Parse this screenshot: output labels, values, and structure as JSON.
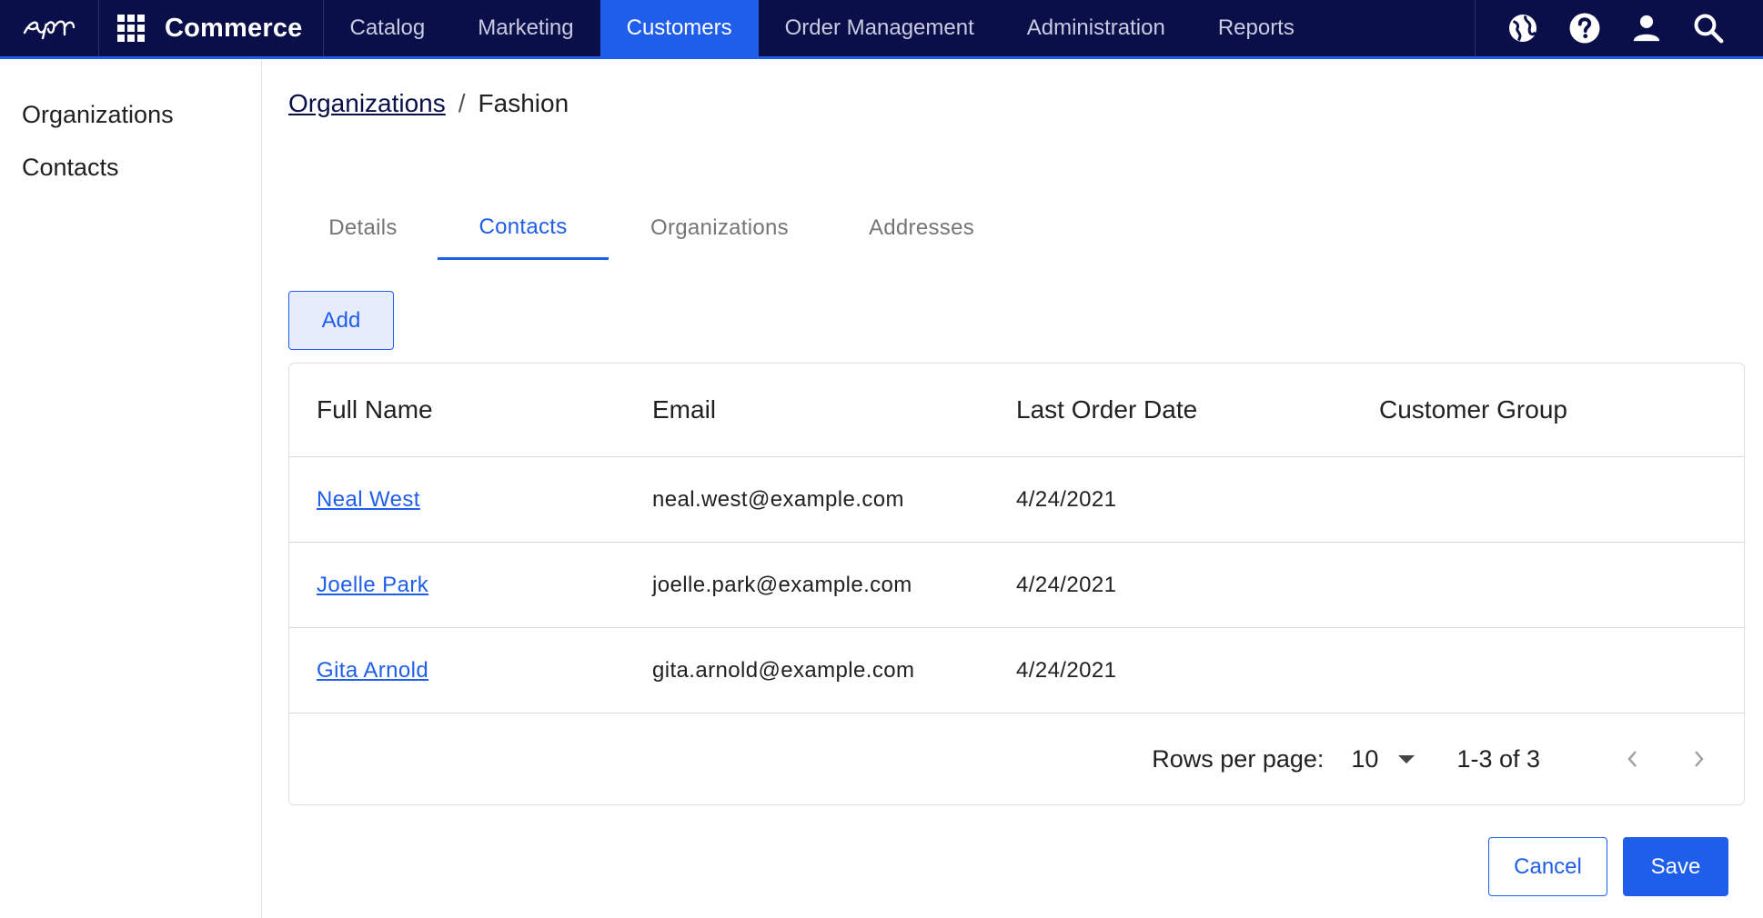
{
  "header": {
    "logo_icon": "epi-logo-icon",
    "app_menu_icon": "apps-grid-icon",
    "app_title": "Commerce",
    "nav": [
      {
        "label": "Catalog",
        "active": false
      },
      {
        "label": "Marketing",
        "active": false
      },
      {
        "label": "Customers",
        "active": true
      },
      {
        "label": "Order Management",
        "active": false
      },
      {
        "label": "Administration",
        "active": false
      },
      {
        "label": "Reports",
        "active": false
      }
    ],
    "icons": [
      "globe-icon",
      "help-icon",
      "user-icon",
      "search-icon"
    ]
  },
  "sidebar": {
    "items": [
      {
        "label": "Organizations"
      },
      {
        "label": "Contacts"
      }
    ]
  },
  "breadcrumb": {
    "parent": "Organizations",
    "separator": "/",
    "current": "Fashion"
  },
  "tabs": [
    {
      "label": "Details",
      "active": false
    },
    {
      "label": "Contacts",
      "active": true
    },
    {
      "label": "Organizations",
      "active": false
    },
    {
      "label": "Addresses",
      "active": false
    }
  ],
  "toolbar": {
    "add_label": "Add"
  },
  "table": {
    "columns": [
      "Full Name",
      "Email",
      "Last Order Date",
      "Customer Group"
    ],
    "rows": [
      {
        "full_name": "Neal West",
        "email": "neal.west@example.com",
        "last_order_date": "4/24/2021",
        "customer_group": ""
      },
      {
        "full_name": "Joelle Park",
        "email": "joelle.park@example.com",
        "last_order_date": "4/24/2021",
        "customer_group": ""
      },
      {
        "full_name": "Gita Arnold",
        "email": "gita.arnold@example.com",
        "last_order_date": "4/24/2021",
        "customer_group": ""
      }
    ]
  },
  "pagination": {
    "rows_per_page_label": "Rows per page:",
    "rows_per_page_value": "10",
    "range": "1-3 of 3"
  },
  "actions": {
    "cancel_label": "Cancel",
    "save_label": "Save"
  },
  "colors": {
    "header_bg": "#0a0f4a",
    "accent": "#1f5eea"
  }
}
